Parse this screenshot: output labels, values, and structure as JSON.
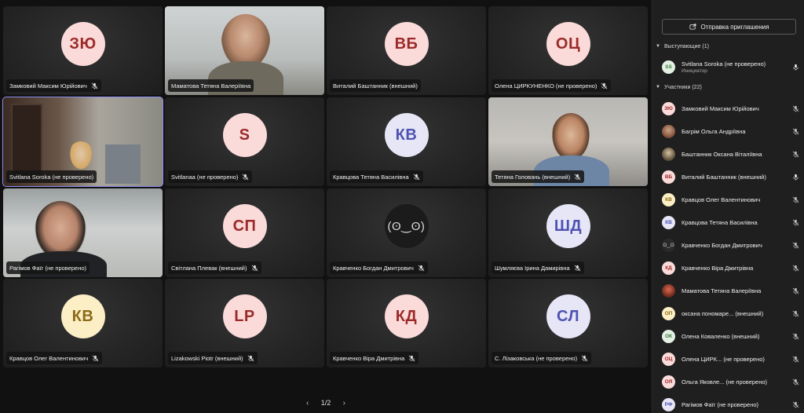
{
  "tiles": [
    {
      "name": "Замковий Максим Юрійович",
      "initials": "ЗЮ",
      "bg": "#fbdada",
      "fg": "#9b2b28",
      "muted": true
    },
    {
      "name": "Маматова Тетяна Валеріївна",
      "video": true,
      "muted": false
    },
    {
      "name": "Виталий Баштанник (внешний)",
      "initials": "ВБ",
      "bg": "#fbdada",
      "fg": "#9b2b28",
      "muted": false
    },
    {
      "name": "Олена ЦИРКУНЕНКО (не проверено)",
      "initials": "ОЦ",
      "bg": "#fbdada",
      "fg": "#9b2b28",
      "muted": true
    },
    {
      "name": "Svitlana Soroka (не проверено)",
      "video": true,
      "muted": false
    },
    {
      "name": "Svitlanaa (не проверено)",
      "initials": "S",
      "bg": "#fbdada",
      "fg": "#9b2b28",
      "muted": true
    },
    {
      "name": "Кравцова Тетяна Василівна",
      "initials": "КВ",
      "bg": "#e6e6f7",
      "fg": "#4f52b2",
      "muted": true
    },
    {
      "name": "Тетяна Головань (внешний)",
      "video": true,
      "muted": true
    },
    {
      "name": "Рагімов Фаїг (не проверено)",
      "video": true,
      "muted": false
    },
    {
      "name": "Світлана Плевак (внешний)",
      "initials": "СП",
      "bg": "#fbdada",
      "fg": "#9b2b28",
      "muted": true
    },
    {
      "name": "Кравченко Богдан Дмитрович",
      "initials": "(ʘ‿ʘ)",
      "bg": "#1b1b1b",
      "fg": "#dcdcdc",
      "dark": true,
      "muted": true
    },
    {
      "name": "Шумляєва Ірина Дамирівна",
      "initials": "ШД",
      "bg": "#e6e6f7",
      "fg": "#4f52b2",
      "muted": true
    },
    {
      "name": "Кравцов Олег Валентинович",
      "initials": "КВ",
      "bg": "#fcefc6",
      "fg": "#8a6a16",
      "muted": true
    },
    {
      "name": "Lizakowski Piotr (внешний)",
      "initials": "LP",
      "bg": "#fbdada",
      "fg": "#9b2b28",
      "muted": true
    },
    {
      "name": "Кравченко Віра Дмитрівна",
      "initials": "КД",
      "bg": "#fbdada",
      "fg": "#9b2b28",
      "muted": true
    },
    {
      "name": "С. Лізаковська (не проверено)",
      "initials": "СЛ",
      "bg": "#e6e6f7",
      "fg": "#4f52b2",
      "muted": true
    }
  ],
  "pager": {
    "label": "1/2",
    "prev": "‹",
    "next": "›"
  },
  "panel": {
    "invite_label": "Отправка приглашения",
    "presenters_header": "Выступающие (1)",
    "participants_header": "Участники (22)",
    "presenters": [
      {
        "name": "Svitlana Soroka (не проверено)",
        "role": "Инициатор",
        "initials": "SS",
        "bg": "#e3f1e3",
        "fg": "#3a7a3a",
        "mic": "on"
      }
    ],
    "participants": [
      {
        "name": "Замковий Максим Юрійович",
        "initials": "ЗЮ",
        "bg": "#fbdada",
        "fg": "#9b2b28",
        "mic": "off"
      },
      {
        "name": "Багрім Ольга Андріївна",
        "initials": "",
        "photo": "photo",
        "mic": "off"
      },
      {
        "name": "Баштанник Оксана Віталіївна",
        "initials": "",
        "photo": "photo2",
        "mic": "off"
      },
      {
        "name": "Виталий Баштанник (внешний)",
        "initials": "ВБ",
        "bg": "#fbdada",
        "fg": "#9b2b28",
        "mic": "on"
      },
      {
        "name": "Кравцов Олег Валентинович",
        "initials": "КВ",
        "bg": "#fcefc6",
        "fg": "#8a6a16",
        "mic": "off"
      },
      {
        "name": "Кравцова Тетяна Василівна",
        "initials": "КВ",
        "bg": "#e6e6f7",
        "fg": "#4f52b2",
        "mic": "off"
      },
      {
        "name": "Кравченко Богдан Дмитрович",
        "initials": "ʘ‿ʘ",
        "dark": true,
        "mic": "off"
      },
      {
        "name": "Кравченко Віра Дмитрівна",
        "initials": "КД",
        "bg": "#fbdada",
        "fg": "#9b2b28",
        "mic": "off"
      },
      {
        "name": "Маматова Тетяна Валеріївна",
        "initials": "",
        "photo": "photo3",
        "mic": "off"
      },
      {
        "name": "оксана пономаре...   (внешний)",
        "initials": "ОП",
        "bg": "#fcefc6",
        "fg": "#8a6a16",
        "mic": "off"
      },
      {
        "name": "Олена Коваленко (внешний)",
        "initials": "ОК",
        "bg": "#e3f1e3",
        "fg": "#3a7a3a",
        "mic": "off"
      },
      {
        "name": "Олена ЦИРК...   (не проверено)",
        "initials": "ОЦ",
        "bg": "#fbdada",
        "fg": "#9b2b28",
        "mic": "off"
      },
      {
        "name": "Ольга Яковле...   (не проверено)",
        "initials": "ОЯ",
        "bg": "#fbdada",
        "fg": "#9b2b28",
        "mic": "off"
      },
      {
        "name": "Рагімов Фаїг (не проверено)",
        "initials": "РФ",
        "bg": "#e6e6f7",
        "fg": "#4f52b2",
        "mic": "off"
      }
    ]
  }
}
